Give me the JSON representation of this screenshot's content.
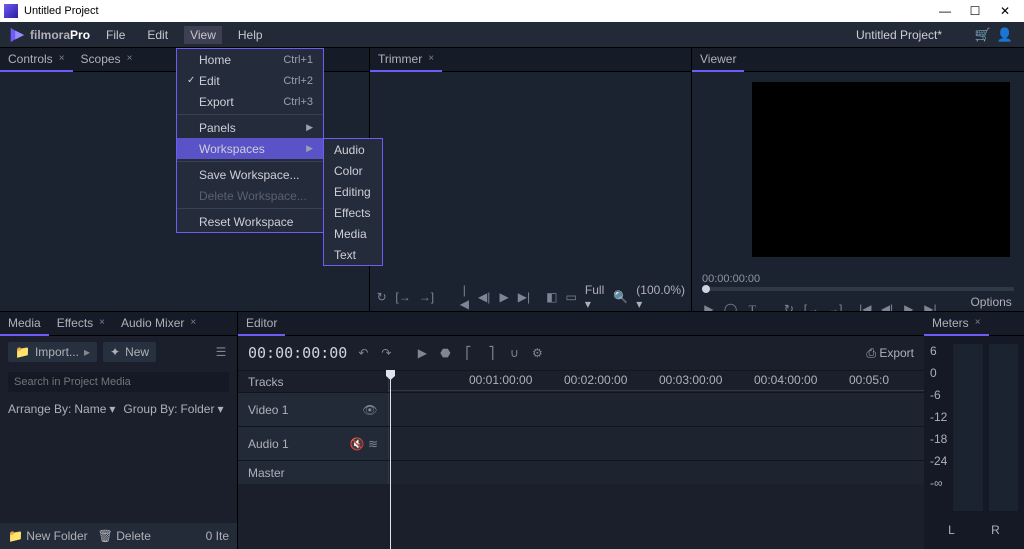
{
  "window": {
    "title": "Untitled Project"
  },
  "winctrl": {
    "min": "—",
    "max": "☐",
    "close": "✕"
  },
  "brand": {
    "name": "filmora",
    "suffix": "Pro"
  },
  "menu": {
    "file": "File",
    "edit": "Edit",
    "view": "View",
    "help": "Help"
  },
  "project_title": "Untitled Project*",
  "view_dd": {
    "home": {
      "l": "Home",
      "s": "Ctrl+1"
    },
    "edit": {
      "l": "Edit",
      "s": "Ctrl+2",
      "checked": true
    },
    "export": {
      "l": "Export",
      "s": "Ctrl+3"
    },
    "panels": {
      "l": "Panels"
    },
    "workspaces": {
      "l": "Workspaces"
    },
    "save_ws": {
      "l": "Save Workspace..."
    },
    "delete_ws": {
      "l": "Delete Workspace..."
    },
    "reset_ws": {
      "l": "Reset Workspace"
    }
  },
  "ws_sub": {
    "audio": "Audio",
    "color": "Color",
    "editing": "Editing",
    "effects": "Effects",
    "media": "Media",
    "text": "Text"
  },
  "panels": {
    "controls": "Controls",
    "scopes": "Scopes",
    "trimmer": "Trimmer",
    "viewer": "Viewer",
    "media": "Media",
    "effects": "Effects",
    "audio_mixer": "Audio Mixer",
    "editor": "Editor",
    "meters": "Meters"
  },
  "viewer": {
    "tc": "00:00:00:00",
    "options": "Options"
  },
  "trimmer": {
    "full": "Full",
    "zoom": "(100.0%)"
  },
  "media": {
    "import": "Import...",
    "new": "New",
    "search_ph": "Search in Project Media",
    "arrange": "Arrange By:",
    "arrange_v": "Name",
    "group": "Group By:",
    "group_v": "Folder",
    "newfolder": "New Folder",
    "delete": "Delete",
    "items": "0 Ite"
  },
  "editor": {
    "tc": "00:00:00:00",
    "export": "Export",
    "tracks_lbl": "Tracks",
    "ruler": [
      "00:01:00:00",
      "00:02:00:00",
      "00:03:00:00",
      "00:04:00:00",
      "00:05:0"
    ],
    "video1": "Video 1",
    "audio1": "Audio 1",
    "master": "Master"
  },
  "meters": {
    "scale": [
      "6",
      "0",
      "-6",
      "-12",
      "-18",
      "-24",
      "-∞"
    ],
    "L": "L",
    "R": "R"
  }
}
